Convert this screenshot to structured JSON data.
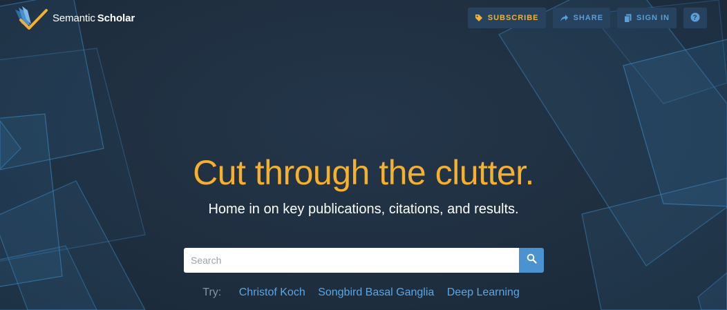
{
  "header": {
    "logo_name_regular": "Semantic",
    "logo_name_bold": "Scholar",
    "logo_icon": "book-check-icon"
  },
  "nav": {
    "subscribe": {
      "label": "SUBSCRIBE",
      "icon": "tag-icon",
      "color": "#f2b32f"
    },
    "share": {
      "label": "SHARE",
      "icon": "share-arrow-icon",
      "color": "#5c9ed6"
    },
    "signin": {
      "label": "SIGN IN",
      "icon": "document-icon",
      "color": "#5c9ed6"
    },
    "help": {
      "icon": "question-icon"
    }
  },
  "hero": {
    "headline": "Cut through the clutter.",
    "subheadline": "Home in on key publications, citations, and results."
  },
  "search": {
    "placeholder": "Search",
    "value": "",
    "button_icon": "search-icon"
  },
  "try": {
    "label": "Try:",
    "links": [
      "Christof Koch",
      "Songbird Basal Ganglia",
      "Deep Learning"
    ]
  },
  "colors": {
    "background": "#1f2f40",
    "accent_orange": "#f5b02e",
    "link_blue": "#5aa6e6",
    "button_bg": "#27425e"
  }
}
